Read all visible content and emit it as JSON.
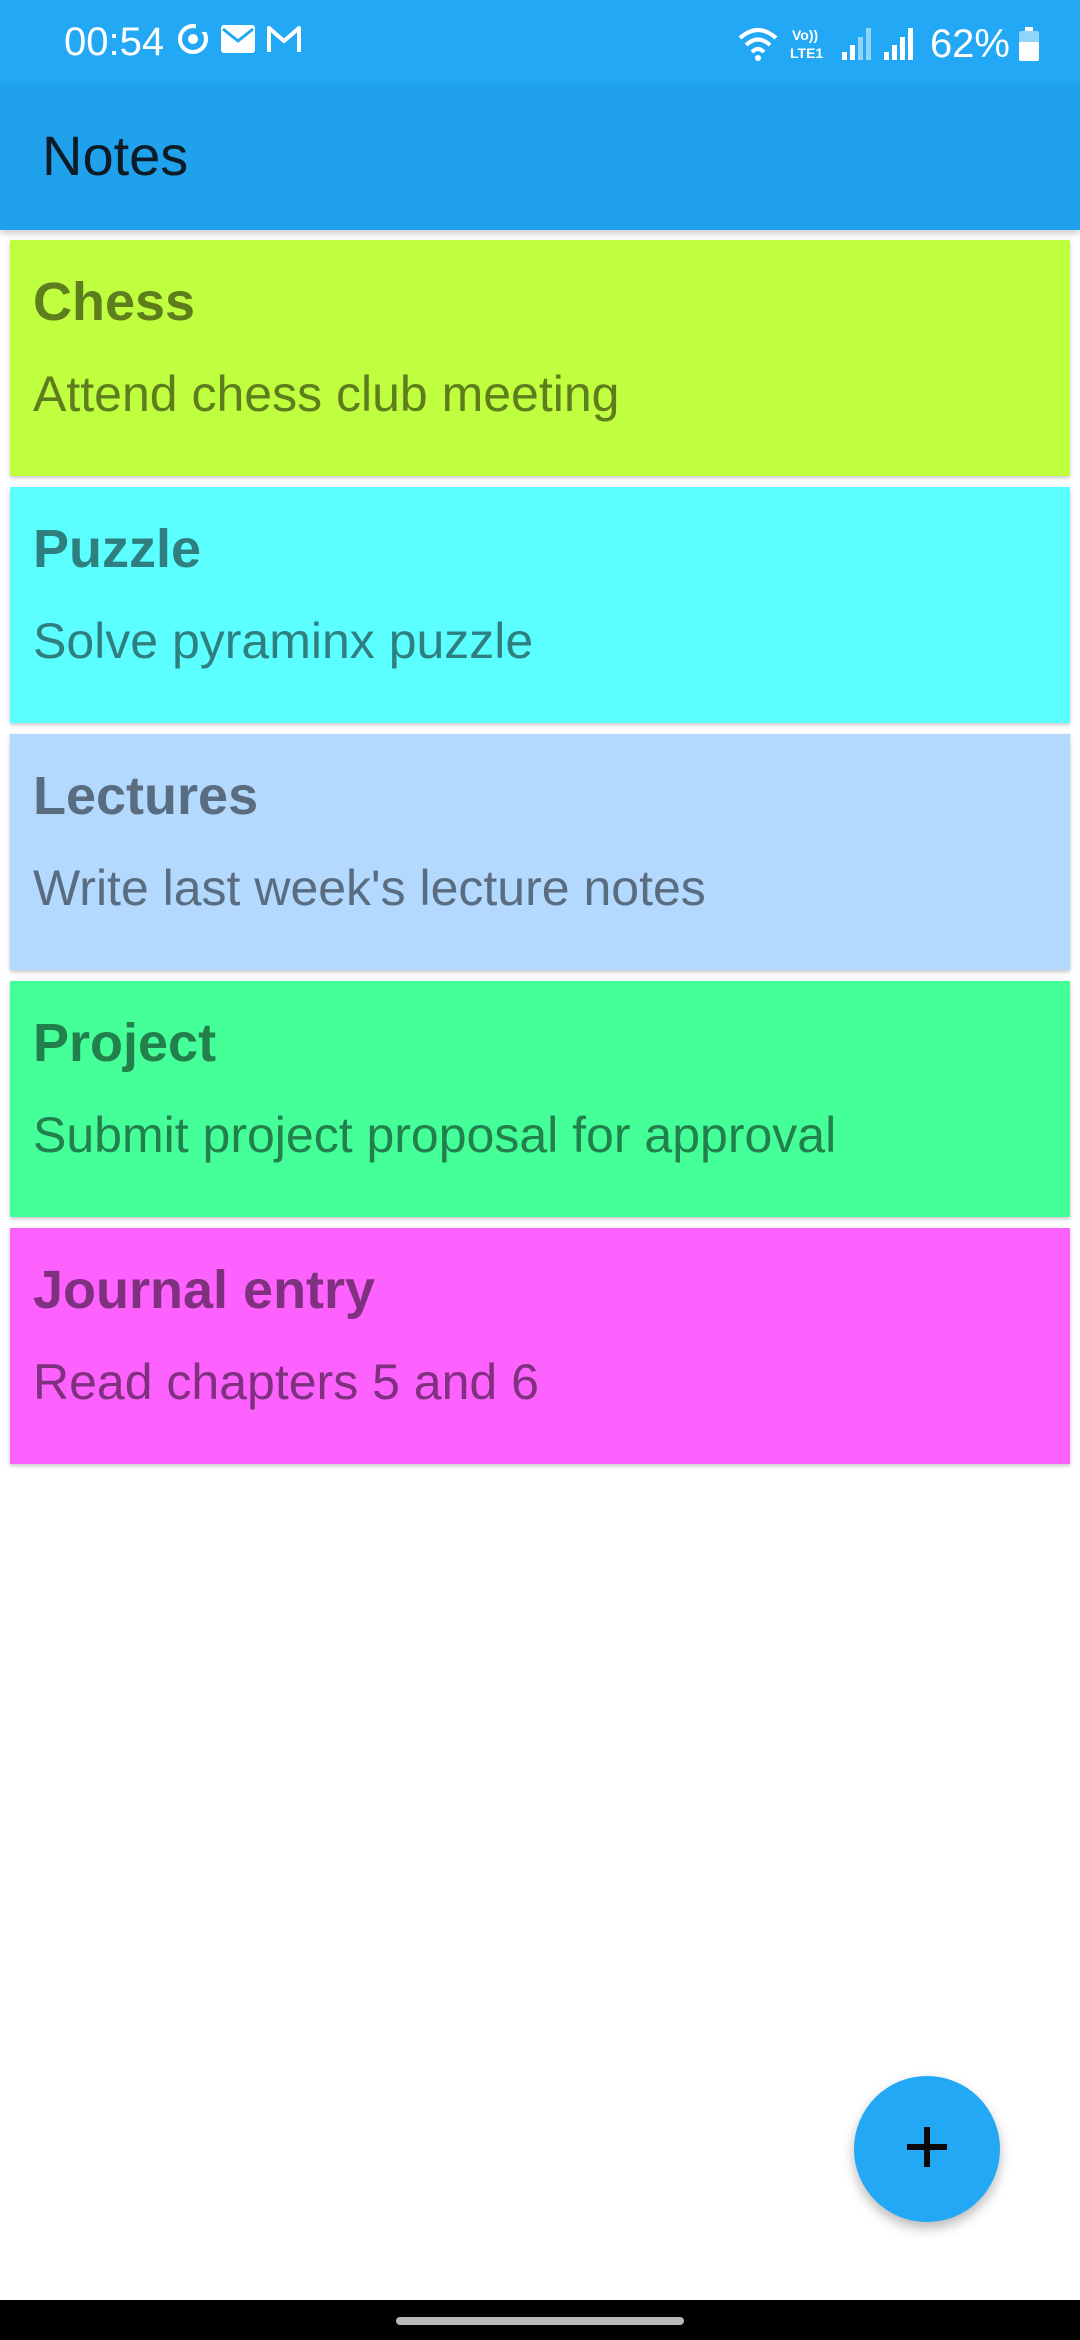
{
  "status_bar": {
    "time": "00:54",
    "left_icons": [
      "sync-icon",
      "email-icon",
      "gmail-icon"
    ],
    "right_icons": [
      "wifi-icon",
      "volte-lte-icon",
      "signal-icon",
      "signal-icon"
    ],
    "battery": "62%"
  },
  "app_bar": {
    "title": "Notes",
    "color": "#1fa1ec"
  },
  "notes": [
    {
      "title": "Chess",
      "body": "Attend chess club meeting",
      "bg": "#bfff3f",
      "fg": "#5e7d1c"
    },
    {
      "title": "Puzzle",
      "body": "Solve pyraminx puzzle",
      "bg": "#5cffff",
      "fg": "#2f7f80"
    },
    {
      "title": "Lectures",
      "body": "Write last week's lecture notes",
      "bg": "#b3d9fe",
      "fg": "#5a6c7f"
    },
    {
      "title": "Project",
      "body": "Submit project proposal for approval",
      "bg": "#45ff99",
      "fg": "#22804c"
    },
    {
      "title": "Journal entry",
      "body": "Read chapters 5 and 6",
      "bg": "#fd61fe",
      "fg": "#7f307e"
    }
  ],
  "fab": {
    "icon": "plus-icon",
    "color": "#22a8f4"
  }
}
